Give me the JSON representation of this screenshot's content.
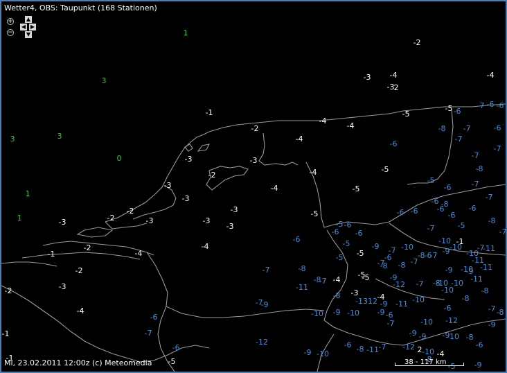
{
  "header": {
    "title": "Wetter4, OBS: Taupunkt (168 Stationen)"
  },
  "footer": {
    "credit": "Mi, 23.02.2011 12:00z (c) Meteomedia",
    "scale_label": "38 - 117 km"
  },
  "controls": {
    "zoom_in_icon": "magnifier-plus",
    "zoom_out_icon": "magnifier-minus",
    "pan_icons": [
      "arrow-up",
      "arrow-left",
      "arrow-right",
      "arrow-down"
    ]
  },
  "colors": {
    "sea_stations": "#33cc33",
    "land_stations": "#ffffff",
    "cold_stations": "#3f8fe0",
    "coastline": "#9a9a9a",
    "background": "#000000"
  },
  "stations": [
    {
      "v": "1",
      "c": "g"
    },
    {
      "v": "3",
      "c": "g"
    },
    {
      "v": "3",
      "c": "g"
    },
    {
      "v": "3",
      "c": "g"
    },
    {
      "v": "0",
      "c": "g"
    },
    {
      "v": "1",
      "c": "g"
    },
    {
      "v": "1",
      "c": "g"
    },
    {
      "v": "-2",
      "c": "w"
    },
    {
      "v": "-3",
      "c": "w"
    },
    {
      "v": "-4",
      "c": "w"
    },
    {
      "v": "-4",
      "c": "w"
    },
    {
      "v": "-3",
      "c": "w"
    },
    {
      "v": "2",
      "c": "w"
    },
    {
      "v": "-1",
      "c": "w"
    },
    {
      "v": "-5",
      "c": "w"
    },
    {
      "v": "-5",
      "c": "w"
    },
    {
      "v": "-4",
      "c": "w"
    },
    {
      "v": "-4",
      "c": "w"
    },
    {
      "v": "-2",
      "c": "w"
    },
    {
      "v": "-4",
      "c": "w"
    },
    {
      "v": "-3",
      "c": "w"
    },
    {
      "v": "-2",
      "c": "w"
    },
    {
      "v": "-3",
      "c": "w"
    },
    {
      "v": "-4",
      "c": "w"
    },
    {
      "v": "-5",
      "c": "w"
    },
    {
      "v": "-3",
      "c": "w"
    },
    {
      "v": "-4",
      "c": "w"
    },
    {
      "v": "-5",
      "c": "w"
    },
    {
      "v": "-3",
      "c": "w"
    },
    {
      "v": "-2",
      "c": "w"
    },
    {
      "v": "-3",
      "c": "w"
    },
    {
      "v": "-3",
      "c": "w"
    },
    {
      "v": "-3",
      "c": "w"
    },
    {
      "v": "-5",
      "c": "w"
    },
    {
      "v": "-2",
      "c": "w"
    },
    {
      "v": "-3",
      "c": "w"
    },
    {
      "v": "-3",
      "c": "w"
    },
    {
      "v": "-1",
      "c": "w"
    },
    {
      "v": "-2",
      "c": "w"
    },
    {
      "v": "-4",
      "c": "w"
    },
    {
      "v": "-4",
      "c": "w"
    },
    {
      "v": "-1",
      "c": "w"
    },
    {
      "v": "-2",
      "c": "w"
    },
    {
      "v": "-3",
      "c": "w"
    },
    {
      "v": "-4",
      "c": "w"
    },
    {
      "v": "-5",
      "c": "w"
    },
    {
      "v": "-5",
      "c": "w"
    },
    {
      "v": "-4",
      "c": "w"
    },
    {
      "v": "-5",
      "c": "w"
    },
    {
      "v": "-3",
      "c": "w"
    },
    {
      "v": "-4",
      "c": "w"
    },
    {
      "v": "-1",
      "c": "w"
    },
    {
      "v": "-4",
      "c": "w"
    },
    {
      "v": "-5",
      "c": "w"
    },
    {
      "v": "2",
      "c": "w"
    },
    {
      "v": "-1",
      "c": "w"
    },
    {
      "v": "-2",
      "c": "w"
    },
    {
      "v": "-7",
      "c": "b"
    },
    {
      "v": "-6",
      "c": "b"
    },
    {
      "v": "-6",
      "c": "b"
    },
    {
      "v": "-6",
      "c": "b"
    },
    {
      "v": "-8",
      "c": "b"
    },
    {
      "v": "-7",
      "c": "b"
    },
    {
      "v": "-6",
      "c": "b"
    },
    {
      "v": "-6",
      "c": "b"
    },
    {
      "v": "-7",
      "c": "b"
    },
    {
      "v": "-7",
      "c": "b"
    },
    {
      "v": "-7",
      "c": "b"
    },
    {
      "v": "-8",
      "c": "b"
    },
    {
      "v": "-5",
      "c": "b"
    },
    {
      "v": "-6",
      "c": "b"
    },
    {
      "v": "-7",
      "c": "b"
    },
    {
      "v": "-6",
      "c": "b"
    },
    {
      "v": "-8",
      "c": "b"
    },
    {
      "v": "-6",
      "c": "b"
    },
    {
      "v": "-6",
      "c": "b"
    },
    {
      "v": "-6",
      "c": "b"
    },
    {
      "v": "-6",
      "c": "b"
    },
    {
      "v": "-7",
      "c": "b"
    },
    {
      "v": "-6",
      "c": "b"
    },
    {
      "v": "-5",
      "c": "b"
    },
    {
      "v": "-6",
      "c": "b"
    },
    {
      "v": "-8",
      "c": "b"
    },
    {
      "v": "-7",
      "c": "b"
    },
    {
      "v": "-7",
      "c": "b"
    },
    {
      "v": "-5",
      "c": "b"
    },
    {
      "v": "-6",
      "c": "b"
    },
    {
      "v": "-6",
      "c": "b"
    },
    {
      "v": "-6",
      "c": "b"
    },
    {
      "v": "-5",
      "c": "b"
    },
    {
      "v": "-9",
      "c": "b"
    },
    {
      "v": "-10",
      "c": "b"
    },
    {
      "v": "-7",
      "c": "b"
    },
    {
      "v": "-10",
      "c": "b"
    },
    {
      "v": "-8",
      "c": "b"
    },
    {
      "v": "-6",
      "c": "b"
    },
    {
      "v": "-7",
      "c": "b"
    },
    {
      "v": "-9",
      "c": "b"
    },
    {
      "v": "-11",
      "c": "b"
    },
    {
      "v": "-7",
      "c": "b"
    },
    {
      "v": "-10",
      "c": "b"
    },
    {
      "v": "-10",
      "c": "b"
    },
    {
      "v": "-11",
      "c": "b"
    },
    {
      "v": "-5",
      "c": "b"
    },
    {
      "v": "-8",
      "c": "b"
    },
    {
      "v": "-7",
      "c": "b"
    },
    {
      "v": "-6",
      "c": "b"
    },
    {
      "v": "-8",
      "c": "b"
    },
    {
      "v": "-7",
      "c": "b"
    },
    {
      "v": "-7",
      "c": "b"
    },
    {
      "v": "-8",
      "c": "b"
    },
    {
      "v": "-9",
      "c": "b"
    },
    {
      "v": "-9",
      "c": "b"
    },
    {
      "v": "-10",
      "c": "b"
    },
    {
      "v": "-11",
      "c": "b"
    },
    {
      "v": "-11",
      "c": "b"
    },
    {
      "v": "-8",
      "c": "b"
    },
    {
      "v": "-12",
      "c": "b"
    },
    {
      "v": "-13",
      "c": "b"
    },
    {
      "v": "-9",
      "c": "b"
    },
    {
      "v": "-11",
      "c": "b"
    },
    {
      "v": "-9",
      "c": "b"
    },
    {
      "v": "-7",
      "c": "b"
    },
    {
      "v": "-8",
      "c": "b"
    },
    {
      "v": "-10",
      "c": "b"
    },
    {
      "v": "-11",
      "c": "b"
    },
    {
      "v": "-8",
      "c": "b"
    },
    {
      "v": "-7",
      "c": "b"
    },
    {
      "v": "-10",
      "c": "b"
    },
    {
      "v": "-8",
      "c": "b"
    },
    {
      "v": "-8",
      "c": "b"
    },
    {
      "v": "-10",
      "c": "b"
    },
    {
      "v": "-12",
      "c": "b"
    },
    {
      "v": "-10",
      "c": "b"
    },
    {
      "v": "-9",
      "c": "b"
    },
    {
      "v": "-12",
      "c": "b"
    },
    {
      "v": "-9",
      "c": "b"
    },
    {
      "v": "-10",
      "c": "b"
    },
    {
      "v": "-9",
      "c": "b"
    },
    {
      "v": "-6",
      "c": "b"
    },
    {
      "v": "-7",
      "c": "b"
    },
    {
      "v": "-6",
      "c": "b"
    },
    {
      "v": "-7",
      "c": "b"
    },
    {
      "v": "-8",
      "c": "b"
    },
    {
      "v": "-9",
      "c": "b"
    },
    {
      "v": "-10",
      "c": "b"
    },
    {
      "v": "-10",
      "c": "b"
    },
    {
      "v": "-12",
      "c": "b"
    },
    {
      "v": "-8",
      "c": "b"
    },
    {
      "v": "-9",
      "c": "b"
    },
    {
      "v": "-9",
      "c": "b"
    },
    {
      "v": "-8",
      "c": "b"
    },
    {
      "v": "-7",
      "c": "b"
    },
    {
      "v": "-6",
      "c": "b"
    },
    {
      "v": "-9",
      "c": "b"
    },
    {
      "v": "-6",
      "c": "b"
    },
    {
      "v": "-10",
      "c": "b"
    },
    {
      "v": "-11",
      "c": "b"
    },
    {
      "v": "-10",
      "c": "b"
    },
    {
      "v": "-12",
      "c": "b"
    },
    {
      "v": "-9",
      "c": "b"
    },
    {
      "v": "-10",
      "c": "b"
    },
    {
      "v": "-9",
      "c": "b"
    },
    {
      "v": "-7",
      "c": "b"
    },
    {
      "v": "-6",
      "c": "b"
    },
    {
      "v": "-6",
      "c": "b"
    },
    {
      "v": "-7",
      "c": "b"
    },
    {
      "v": "-8",
      "c": "b"
    },
    {
      "v": "-5",
      "c": "b"
    },
    {
      "v": "-9",
      "c": "b"
    },
    {
      "v": "-9",
      "c": "b"
    },
    {
      "v": "-10",
      "c": "b"
    },
    {
      "v": "-8",
      "c": "b"
    },
    {
      "v": "-10",
      "c": "b"
    },
    {
      "v": "-10",
      "c": "b"
    },
    {
      "v": "-9",
      "c": "b"
    }
  ]
}
